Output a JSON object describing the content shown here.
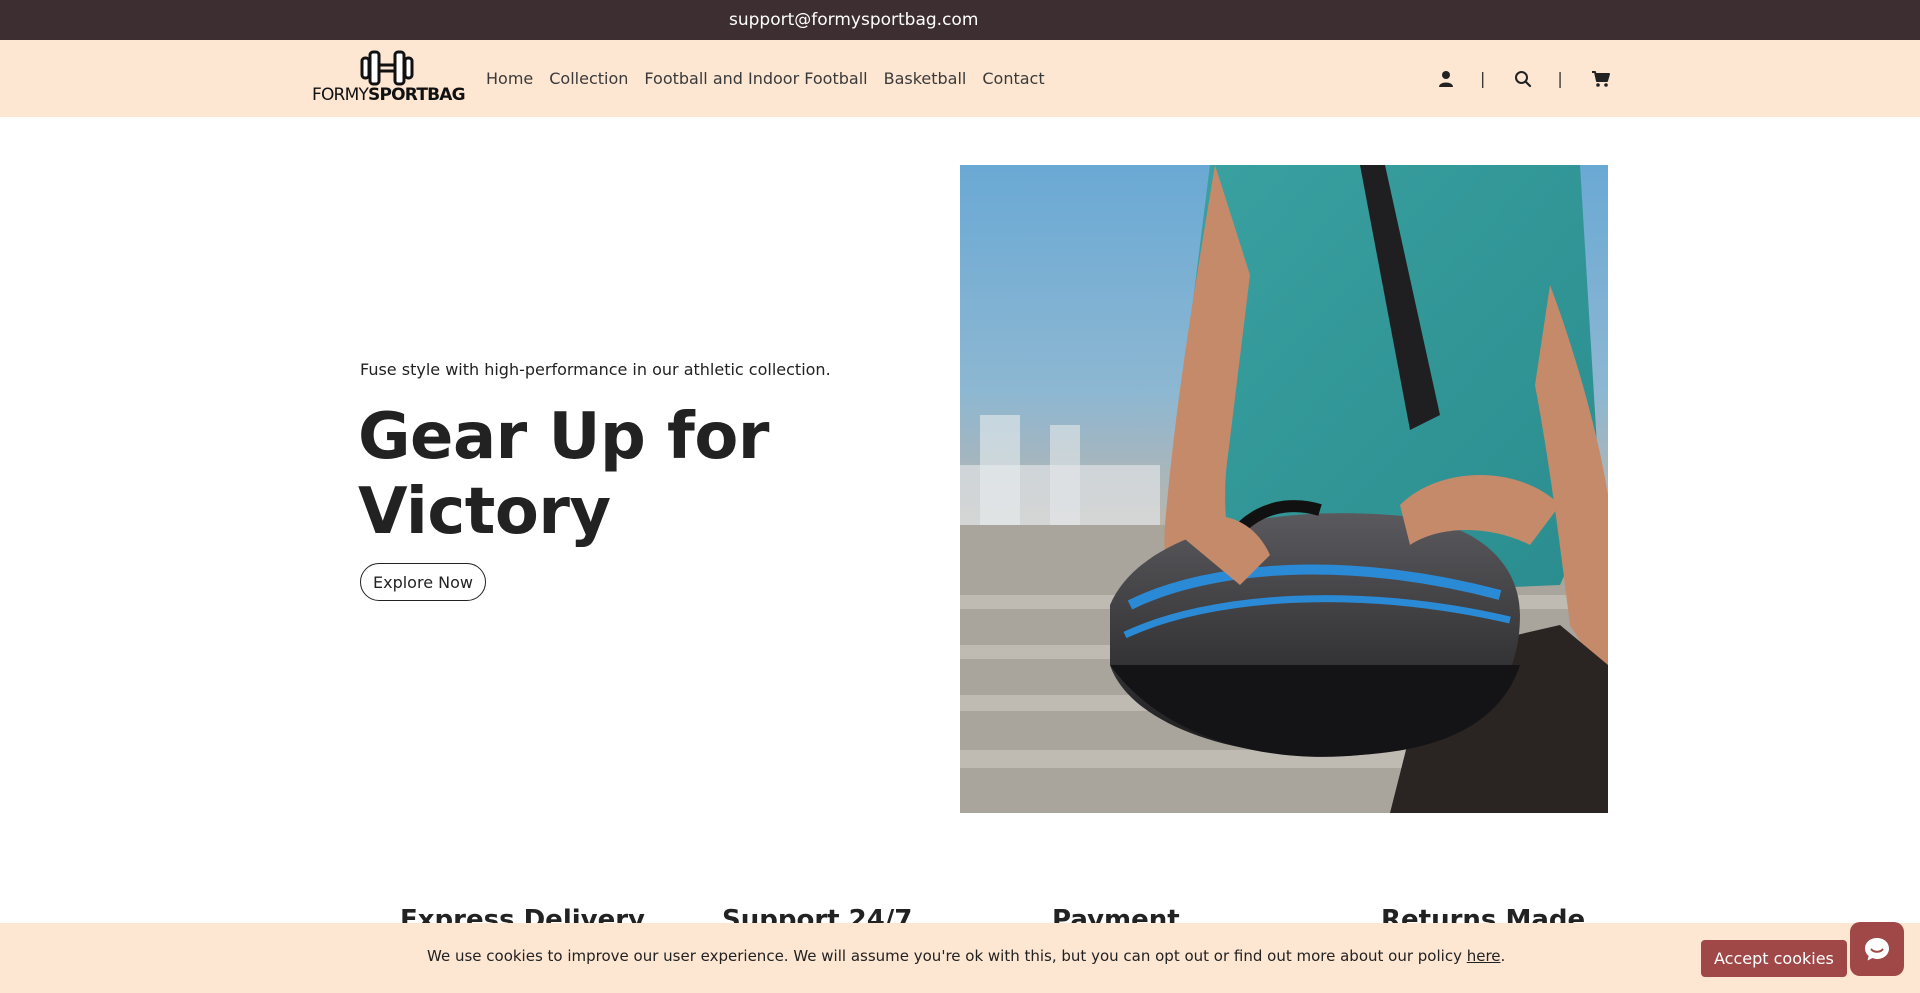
{
  "topbar": {
    "email": "support@formysportbag.com"
  },
  "header": {
    "logo": {
      "text_light": "FORMY",
      "text_bold": "SPORTBAG"
    },
    "nav": [
      {
        "label": "Home"
      },
      {
        "label": "Collection"
      },
      {
        "label": "Football and Indoor Football"
      },
      {
        "label": "Basketball"
      },
      {
        "label": "Contact"
      }
    ],
    "separator": "|",
    "icons": {
      "account": "user-icon",
      "search": "search-icon",
      "cart": "cart-icon"
    }
  },
  "hero": {
    "subtitle": "Fuse style with high-performance in our athletic collection.",
    "title_line1": "Gear Up for",
    "title_line2": "Victory",
    "cta_label": "Explore Now"
  },
  "features": [
    {
      "title": "Express Delivery"
    },
    {
      "title": "Support 24/7"
    },
    {
      "title": "Payment"
    },
    {
      "title": "Returns Made"
    }
  ],
  "cookie": {
    "message": "We use cookies to improve our user experience. We will assume you're ok with this, but you can opt out or find out more about our policy ",
    "link_label": "here",
    "suffix": ".",
    "accept_label": "Accept cookies"
  },
  "chat": {
    "icon": "chat-icon"
  },
  "colors": {
    "topbar": "#3d2f31",
    "header": "#fde6d2",
    "accent": "#a04848"
  }
}
